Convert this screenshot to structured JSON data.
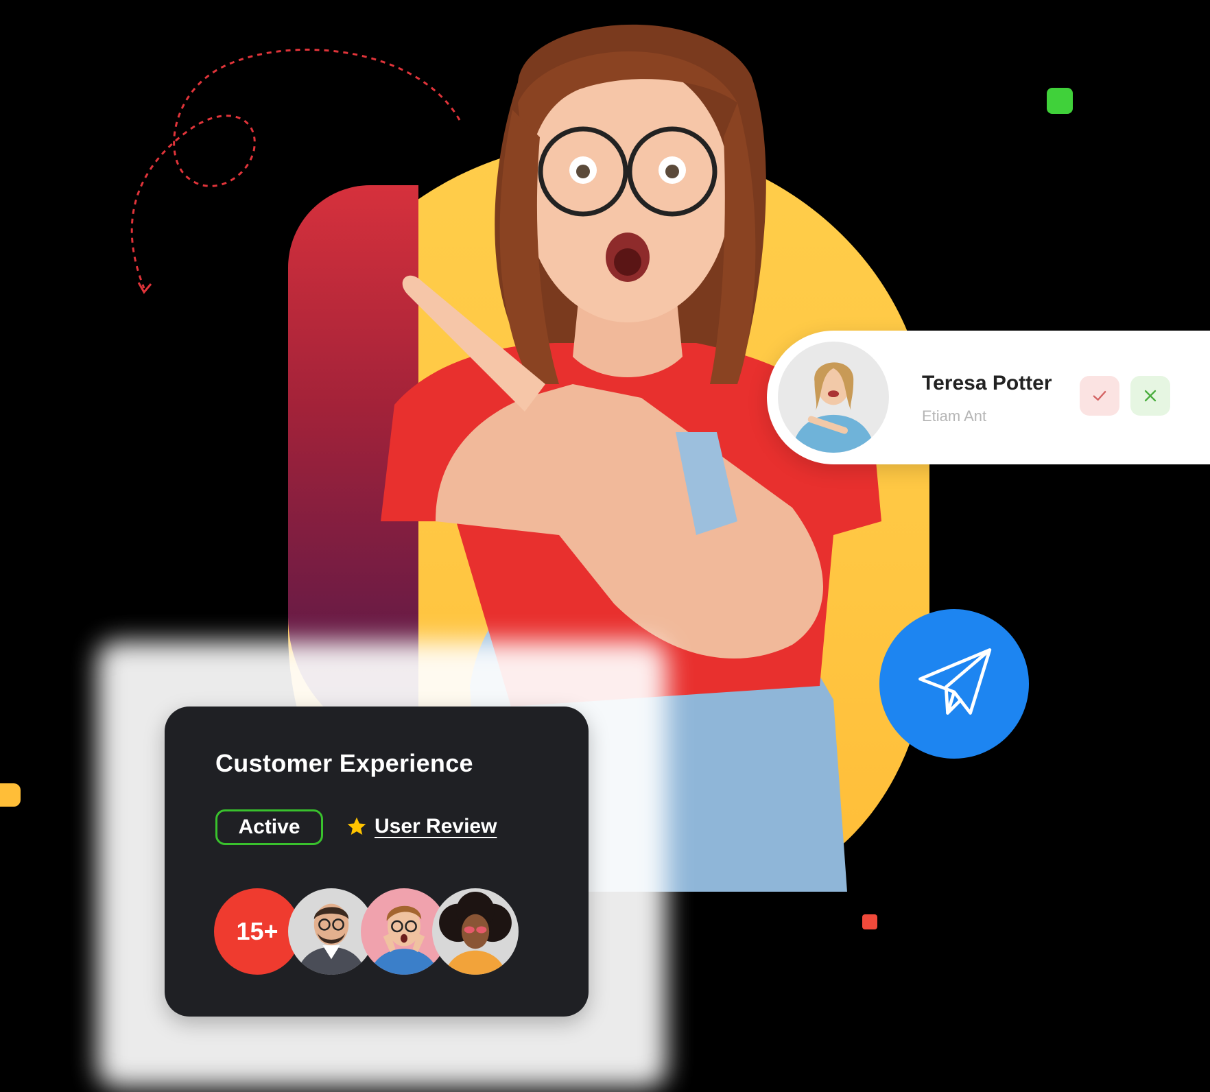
{
  "profile_card": {
    "name": "Teresa Potter",
    "subtitle": "Etiam Ant",
    "accept_icon": "check-icon",
    "decline_icon": "close-icon"
  },
  "send_button": {
    "icon": "paper-plane-icon"
  },
  "experience_card": {
    "title": "Customer Experience",
    "status_label": "Active",
    "review_label": "User Review",
    "review_icon": "star-icon",
    "avatar_count_label": "15+"
  },
  "colors": {
    "card_background": "#1f2024",
    "active_border": "#39c12d",
    "accent_red": "#ef3b2f",
    "send_blue": "#1d85f1",
    "blob_yellow": "#ffc743",
    "star_yellow": "#ffc400",
    "accept_bg": "#fbe3e2",
    "decline_bg": "#e6f6e2"
  }
}
